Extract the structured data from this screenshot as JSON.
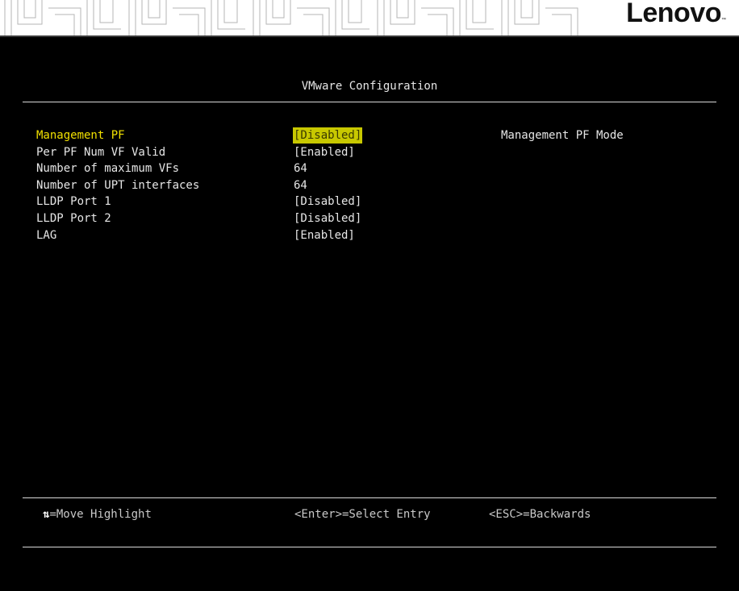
{
  "brand": {
    "logo_text": "Lenovo",
    "tm": "™"
  },
  "page": {
    "title": "VMware Configuration"
  },
  "settings": [
    {
      "label": "Management PF",
      "value": "[Disabled]",
      "selected": true
    },
    {
      "label": "Per PF Num VF Valid",
      "value": "[Enabled]",
      "selected": false
    },
    {
      "label": "Number of maximum VFs",
      "value": "64",
      "selected": false
    },
    {
      "label": "Number of UPT interfaces",
      "value": "64",
      "selected": false
    },
    {
      "label": "LLDP Port 1",
      "value": "[Disabled]",
      "selected": false
    },
    {
      "label": "LLDP Port 2",
      "value": "[Disabled]",
      "selected": false
    },
    {
      "label": "LAG",
      "value": "[Enabled]",
      "selected": false
    }
  ],
  "help": {
    "text": "Management PF Mode"
  },
  "footer": {
    "move_arrows": "⇅",
    "move": "=Move Highlight",
    "select": "<Enter>=Select Entry",
    "back": "<ESC>=Backwards"
  },
  "colors": {
    "background": "#000000",
    "text": "#e6e6e6",
    "highlight_text": "#f2e100",
    "highlight_bg": "#c8c800",
    "banner": "#ffffff"
  }
}
